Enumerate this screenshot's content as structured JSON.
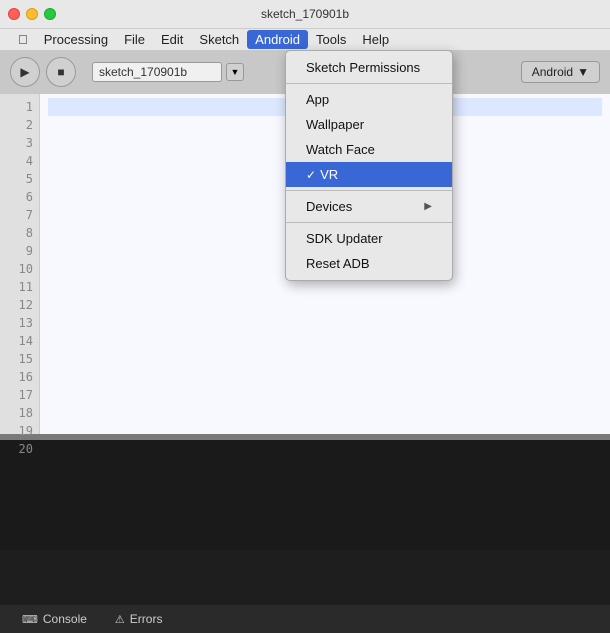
{
  "titleBar": {
    "title": "sketch_170901b",
    "trafficLights": [
      "red",
      "yellow",
      "green"
    ]
  },
  "menuBar": {
    "appleLabel": "",
    "items": [
      {
        "label": "Processing",
        "active": false
      },
      {
        "label": "File",
        "active": false
      },
      {
        "label": "Edit",
        "active": false
      },
      {
        "label": "Sketch",
        "active": false
      },
      {
        "label": "Android",
        "active": true
      },
      {
        "label": "Tools",
        "active": false
      },
      {
        "label": "Help",
        "active": false
      }
    ]
  },
  "toolbar": {
    "playBtn": "▶",
    "stopBtn": "■",
    "sketchName": "sketch_170901b",
    "dropdownArrow": "▼",
    "androidBtn": "Android",
    "androidArrow": "▼"
  },
  "editor": {
    "lines": [
      "1",
      "2",
      "3",
      "4",
      "5",
      "6",
      "7",
      "8",
      "9",
      "10",
      "11",
      "12",
      "13",
      "14",
      "15",
      "16",
      "17",
      "18",
      "19",
      "20"
    ]
  },
  "dropdown": {
    "items": [
      {
        "label": "Sketch Permissions",
        "type": "item",
        "checked": false,
        "hasArrow": false
      },
      {
        "type": "separator"
      },
      {
        "label": "App",
        "type": "item",
        "checked": false,
        "hasArrow": false
      },
      {
        "label": "Wallpaper",
        "type": "item",
        "checked": false,
        "hasArrow": false
      },
      {
        "label": "Watch Face",
        "type": "item",
        "checked": false,
        "hasArrow": false
      },
      {
        "label": "VR",
        "type": "item",
        "checked": true,
        "hasArrow": false
      },
      {
        "type": "separator"
      },
      {
        "label": "Devices",
        "type": "item",
        "checked": false,
        "hasArrow": true
      },
      {
        "type": "separator"
      },
      {
        "label": "SDK Updater",
        "type": "item",
        "checked": false,
        "hasArrow": false
      },
      {
        "label": "Reset ADB",
        "type": "item",
        "checked": false,
        "hasArrow": false
      }
    ]
  },
  "statusBar": {
    "tabs": [
      {
        "label": "Console",
        "icon": ">_"
      },
      {
        "label": "Errors",
        "icon": "⚠"
      }
    ]
  }
}
